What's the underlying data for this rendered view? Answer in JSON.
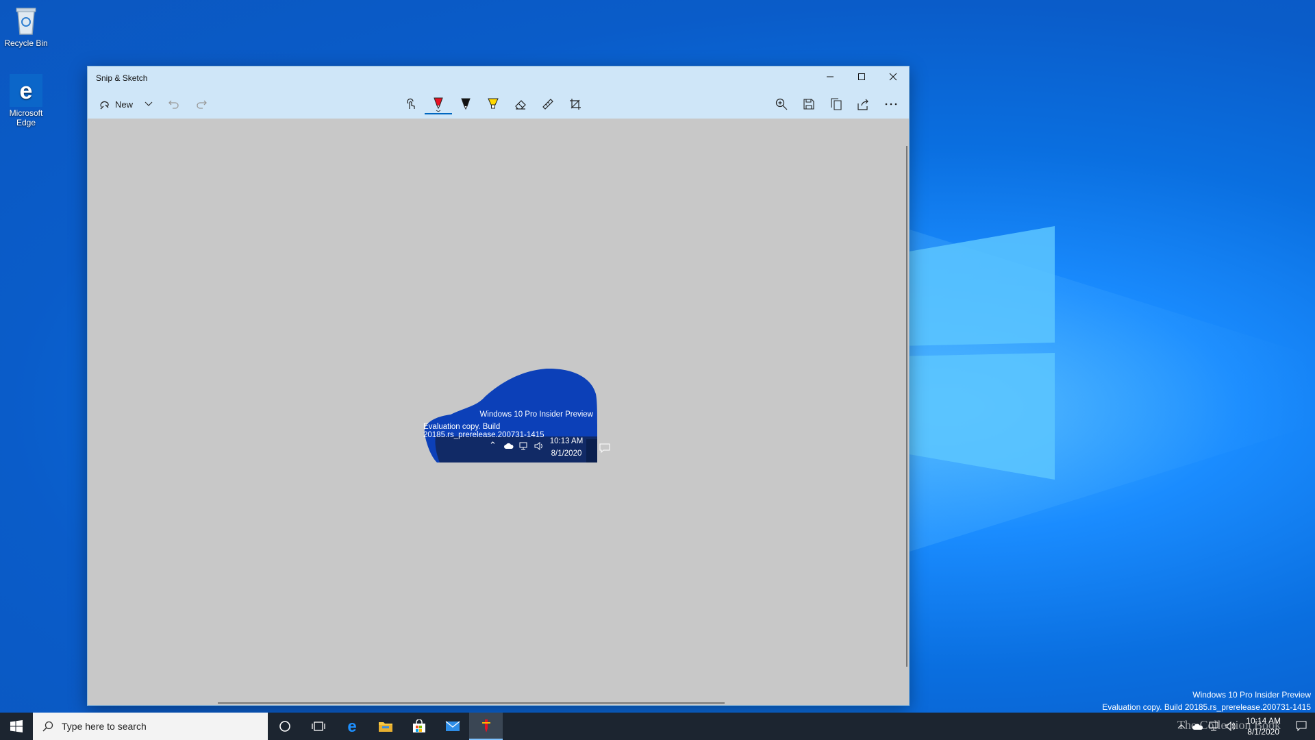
{
  "desktop": {
    "icons": [
      {
        "label": "Recycle Bin"
      },
      {
        "label": "Microsoft Edge"
      }
    ],
    "watermark": {
      "line1": "Windows 10 Pro Insider Preview",
      "line2": "Evaluation copy. Build 20185.rs_prerelease.200731-1415"
    }
  },
  "window": {
    "title": "Snip & Sketch",
    "controls": [
      "minimize",
      "maximize",
      "close"
    ],
    "toolbar": {
      "new_label": "New",
      "tools_center": [
        "touch-writing-icon",
        "ballpoint-pen-icon",
        "pencil-icon",
        "highlighter-icon",
        "eraser-icon",
        "ruler-icon",
        "crop-icon"
      ],
      "active_tool": "ballpoint-pen-icon",
      "tools_right": [
        "zoom-icon",
        "save-icon",
        "copy-icon",
        "share-icon",
        "more-icon"
      ]
    },
    "snip": {
      "line1": "Windows 10 Pro Insider Preview",
      "line2": "Evaluation copy. Build 20185.rs_prerelease.200731-1415",
      "time": "10:13 AM",
      "date": "8/1/2020"
    }
  },
  "taskbar": {
    "search_placeholder": "Type here to search",
    "apps": [
      "cortana-icon",
      "task-view-icon",
      "edge-icon",
      "file-explorer-icon",
      "store-icon",
      "mail-icon",
      "snip-sketch-icon"
    ],
    "active_app": "snip-sketch-icon",
    "clock": {
      "time": "10:14 AM",
      "date": "8/1/2020"
    },
    "overlay_text": "The Collection Book"
  },
  "colors": {
    "accent": "#0067c0",
    "titlebar": "#cfe6f8",
    "canvas": "#c8c8c8",
    "taskbar": "#1c2530",
    "pen_red": "#e81123",
    "highlighter_yellow": "#ffd800"
  }
}
